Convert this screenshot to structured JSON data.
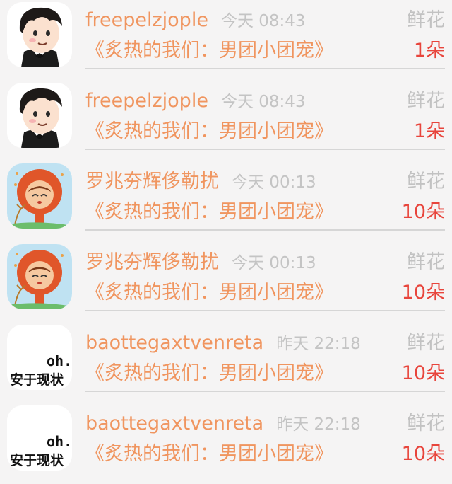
{
  "rows": [
    {
      "name": "freepelzjople",
      "time": "今天 08:43",
      "gift": "鲜花",
      "book": "《炙热的我们：男团小团宠》",
      "count": "1朵",
      "avatar_icon": "cartoon-boy-avatar-icon"
    },
    {
      "name": "freepelzjople",
      "time": "今天 08:43",
      "gift": "鲜花",
      "book": "《炙热的我们：男团小团宠》",
      "count": "1朵",
      "avatar_icon": "cartoon-boy-avatar-icon"
    },
    {
      "name": "罗兆夯辉侈勒扰",
      "time": "今天 00:13",
      "gift": "鲜花",
      "book": "《炙热的我们：男团小团宠》",
      "count": "10朵",
      "avatar_icon": "lion-costume-avatar-icon"
    },
    {
      "name": "罗兆夯辉侈勒扰",
      "time": "今天 00:13",
      "gift": "鲜花",
      "book": "《炙热的我们：男团小团宠》",
      "count": "10朵",
      "avatar_icon": "lion-costume-avatar-icon"
    },
    {
      "name": "baottegaxtvenreta",
      "time": "昨天 22:18",
      "gift": "鲜花",
      "book": "《炙热的我们：男团小团宠》",
      "count": "10朵",
      "avatar_icon": "text-sticker-avatar-icon",
      "avatar_text": [
        "oh.",
        "安于现状"
      ]
    },
    {
      "name": "baottegaxtvenreta",
      "time": "昨天 22:18",
      "gift": "鲜花",
      "book": "《炙热的我们：男团小团宠》",
      "count": "10朵",
      "avatar_icon": "text-sticker-avatar-icon",
      "avatar_text": [
        "oh.",
        "安于现状"
      ]
    }
  ],
  "colors": {
    "name": "#f0955f",
    "time": "#c4c4c4",
    "gift": "#c2c2c2",
    "count": "#e8453c",
    "divider": "#d6d6d6",
    "background": "#f5f4f4"
  }
}
